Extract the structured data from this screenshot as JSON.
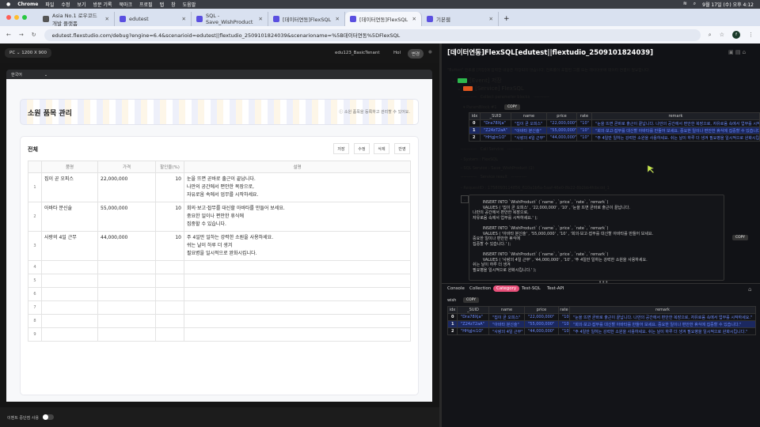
{
  "menubar": {
    "app": "Chrome",
    "items": [
      "파일",
      "수정",
      "보기",
      "방문 기록",
      "북마크",
      "프로필",
      "탭",
      "창",
      "도움말"
    ],
    "clock": "9월 17일 (수) 오후 4:12"
  },
  "tabs": [
    {
      "label": "Asia No.1 로우코드 개발 플랫폼"
    },
    {
      "label": "edutest"
    },
    {
      "label": "SQL - Save_WishProduct"
    },
    {
      "label": "[데이터연동]FlexSQL"
    },
    {
      "label": "[데이터연동]FlexSQL",
      "active": true
    },
    {
      "label": "기본웹"
    }
  ],
  "address": {
    "url": "edutest.flexstudio.com/debug?engine=6.4&scenarioid=edutest||flextudio_2509101824039&scenarioname=%5B데이터연동%5DFlexSQL",
    "avatar": "f"
  },
  "left": {
    "device": "PC",
    "resolution": "1200  X  900",
    "tenant": "edu123_BasicTenant",
    "user": "Hol",
    "change_btn": "변경",
    "language": "한국어",
    "event_toggle_label": "이벤트 중단점 사용",
    "event_toggle_on": false
  },
  "app": {
    "title": "소원 품목 관리",
    "subtitle": "소원 품목을 등록하고 관리할 수 있어요.",
    "section": "전체",
    "buttons": [
      "저장",
      "수정",
      "삭제",
      "반영"
    ],
    "columns": [
      "품명",
      "가격",
      "할인율(%)",
      "설명"
    ],
    "rows": [
      {
        "idx": "1",
        "name": "집이 곧 오피스",
        "price": "22,000,000",
        "rate": "10",
        "remark": [
          "눈을 뜨면 곧바로 출근이 끝납니다.",
          "나만의 공간에서 편안한 복장으로,",
          "자유로움 속에서 업무를 시작하세요."
        ]
      },
      {
        "idx": "2",
        "name": "아바타 분신술",
        "price": "55,000,000",
        "rate": "10",
        "remark": [
          "회의·보고·잡무를 대신할 아바타를 만들어 보세요.",
          "중요한 일이나 편안한 휴식에",
          "집중할 수 있습니다."
        ]
      },
      {
        "idx": "3",
        "name": "사랑의 4일 근무",
        "price": "44,000,000",
        "rate": "10",
        "remark": [
          "주 4일만 일하는 강력한 소원을 사용하세요.",
          "쉬는 날이 하루 더 생겨",
          "필요병을 일시적으로 완화시킵니다."
        ]
      }
    ],
    "empty_rows": [
      "4",
      "5",
      "6",
      "7",
      "8",
      "9"
    ]
  },
  "debug": {
    "title": "[데이터연동]FlexSQL[edutest||flextudio_2509101824039]",
    "warning": "\"Button\" 컨트롤 [저장]에 입력한 내용은 저장되지 않습니다. 컨트롤이 포함된 그룹 또는 레이아웃에 데이터 연결이 필요합니다.",
    "event": "[Event] 저장",
    "service": "[Service] FlexSQL",
    "collect": "-----------   Collect parameter blocks   -----------",
    "param_block": "ParamBlock #1",
    "copy": "COPY",
    "param_columns": [
      "idx",
      "_SUID",
      "name",
      "price",
      "rate",
      "remark"
    ],
    "param_rows": [
      [
        "0",
        "\"Dra78Xja\"",
        "\"집이 곧 오피스\"",
        "\"22,000,000\"",
        "\"10\"",
        "\"눈을 뜨면 곧바로 출근이 끝납니다. 나만의 공간에서 편안한 복장으로, 자유로움 속에서 업무를 시작하세요.\""
      ],
      [
        "1",
        "\"Z24z72aA\"",
        "\"아바타 분신술\"",
        "\"55,000,000\"",
        "\"10\"",
        "\"회의·보고·잡무를 대신할 아바타를 만들어 보세요. 중요한 일이나 편안한 휴식에 집중할 수 있습니다.\""
      ],
      [
        "2",
        "\"HHgJrc1O\"",
        "\"사랑의 4일 근무\"",
        "\"44,000,000\"",
        "\"10\"",
        "\"주 4일만 일하는 강력한 소원을 사용하세요. 쉬는 날이 하루 더 생겨 필요병을 일시적으로 완화시킵니다.\""
      ]
    ],
    "call_service": "-----------   Call Service   -----------",
    "system": "- System : FlexSQL",
    "sql_service": "- SQL Service : Save_WishProduct (1)",
    "service_result": "-----------   Service result   -----------",
    "request_id": "- RequestID : 1758093114856_610a1b6a-5aaf-46e0-8b22-8b2bb4fcbcdd_1",
    "sql": "        INSERT INTO `WishProduct` (`name`, `price`, `rate`, `remark`)\n        VALUES ( '집이 곧 오피스' , '22,000,000' , '10' , '눈을 뜨면 곧바로 출근이 끝납니다.\n나만의 공간에서 편안한 복장으로,\n자유로움 속에서 업무를 시작하세요.' );\n\n        INSERT INTO `WishProduct` (`name`, `price`, `rate`, `remark`)\n        VALUES ( '아바타 분신술' , '55,000,000' , '10' , '회의·보고·잡무를 대신할 아바타를 만들어 보세요.\n중요한 일이나 편안한 휴식에\n집중할 수 있습니다.' );\n\n        INSERT INTO `WishProduct` (`name`, `price`, `rate`, `remark`)\n        VALUES ( '사랑의 4일 근무' , '44,000,000' , '10' , '주 4일만 일하는 강력한 소원을 사용하세요.\n쉬는 날이 하루 더 생겨\n필요병을 일시적으로 완화시킵니다.' );"
  },
  "console": {
    "tabs": [
      "Console",
      "Collection",
      "Category",
      "Test-SQL",
      "Test-API"
    ],
    "active_tab": "Category",
    "active_color": "#e8507a",
    "dataset": "wish",
    "copy": "COPY",
    "selected_row": "1"
  }
}
